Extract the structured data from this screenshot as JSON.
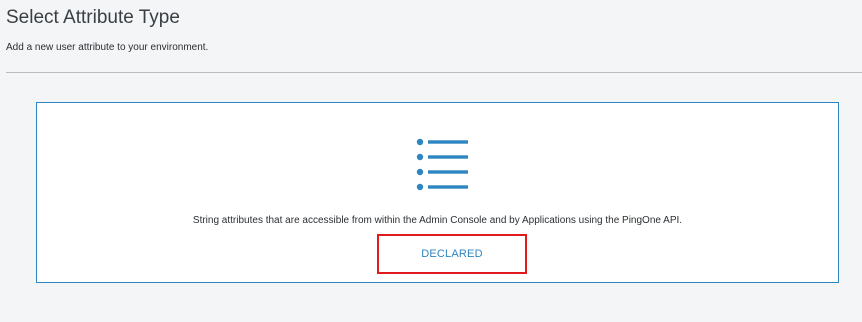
{
  "header": {
    "title": "Select Attribute Type",
    "subtitle": "Add a new user attribute to your environment."
  },
  "card": {
    "icon": "list-icon",
    "description": "String attributes that are accessible from within the Admin Console and by Applications using the PingOne API.",
    "button_label": "DECLARED"
  },
  "colors": {
    "accent": "#2d86c1",
    "highlight": "#e11b1b",
    "background": "#f3f5f7"
  }
}
